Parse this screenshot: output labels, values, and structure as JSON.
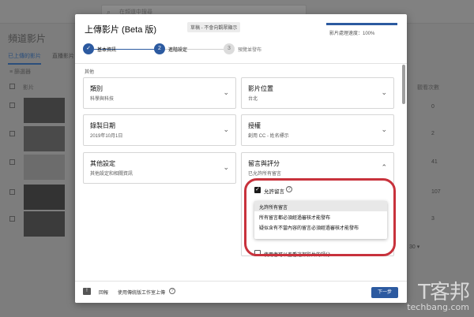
{
  "background": {
    "search_placeholder": "在頻道中搜尋",
    "page_title": "頻道影片",
    "tabs": [
      "已上傳的影片",
      "直播影片"
    ],
    "filter_label": "篩選器",
    "column_video": "影片",
    "column_views": "觀看次數",
    "view_counts": [
      "0",
      "2",
      "41",
      "107",
      "3"
    ],
    "pager": "30 ▾"
  },
  "modal": {
    "title": "上傳影片 (Beta 版)",
    "badge": "草稿 - 不會向觀眾顯示",
    "progress_text": "影片處理速度：100%",
    "steps": [
      {
        "number": "✓",
        "label": "基本資訊"
      },
      {
        "number": "2",
        "label": "進階設定"
      },
      {
        "number": "3",
        "label": "預覽並發布"
      }
    ],
    "section_label": "其他",
    "cards": {
      "category": {
        "title": "類別",
        "value": "科學與科技"
      },
      "location": {
        "title": "影片位置",
        "value": "台北"
      },
      "recording_date": {
        "title": "錄製日期",
        "value": "2019年10月1日"
      },
      "license": {
        "title": "授權",
        "value": "創用 CC - 姓名標示"
      },
      "other_settings": {
        "title": "其他設定",
        "value": "其他設定和相關資訊"
      },
      "comments": {
        "title": "留言與評分",
        "value": "已允許所有留言"
      }
    },
    "allow_comments_label": "允許留言",
    "comment_options": [
      "允許所有留言",
      "所有留言都必須經過審核才能發布",
      "疑似含有不當內容的留言必須經過審核才能發布"
    ],
    "selected_option_index": 0,
    "rating_label": "使用者可以查看這部影片的評分",
    "footer": {
      "feedback_label": "回報",
      "classic_label": "使用傳統版工作室上傳",
      "next_button": "下一步"
    }
  },
  "watermark": {
    "chars": "T客邦",
    "url": "techbang.com"
  },
  "colors": {
    "accent": "#2c5aa0",
    "highlight_ring": "#c8323c",
    "overlay": "#7d7d7d"
  }
}
